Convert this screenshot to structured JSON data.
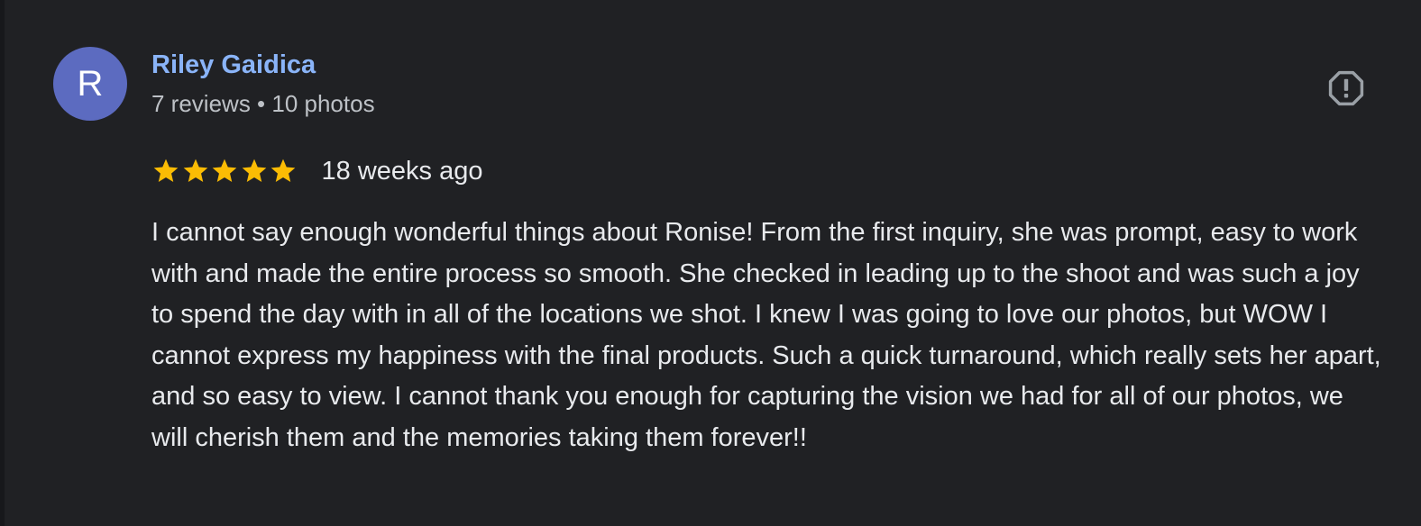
{
  "review": {
    "reviewer": {
      "initial": "R",
      "name": "Riley Gaidica",
      "meta": "7 reviews • 10 photos"
    },
    "rating": 5,
    "time": "18 weeks ago",
    "text": "I cannot say enough wonderful things about Ronise! From the first inquiry, she was prompt, easy to work with and made the entire process so smooth. She checked in leading up to the shoot and was such a joy to spend the day with in all of the locations we shot. I knew I was going to love our photos, but WOW I cannot express my happiness with the final products. Such a quick turnaround, which really sets her apart, and so easy to view. I cannot thank you enough for capturing the vision we had for all of our photos, we will cherish them and the memories taking them forever!!"
  },
  "icons": {
    "star": "star-icon",
    "report": "report-octagon-icon"
  },
  "colors": {
    "background": "#202124",
    "avatar": "#5c6bc0",
    "name": "#8ab4f8",
    "star": "#fbbc04",
    "text": "#e8eaed",
    "meta": "#bdc1c6",
    "icon": "#9aa0a6"
  }
}
